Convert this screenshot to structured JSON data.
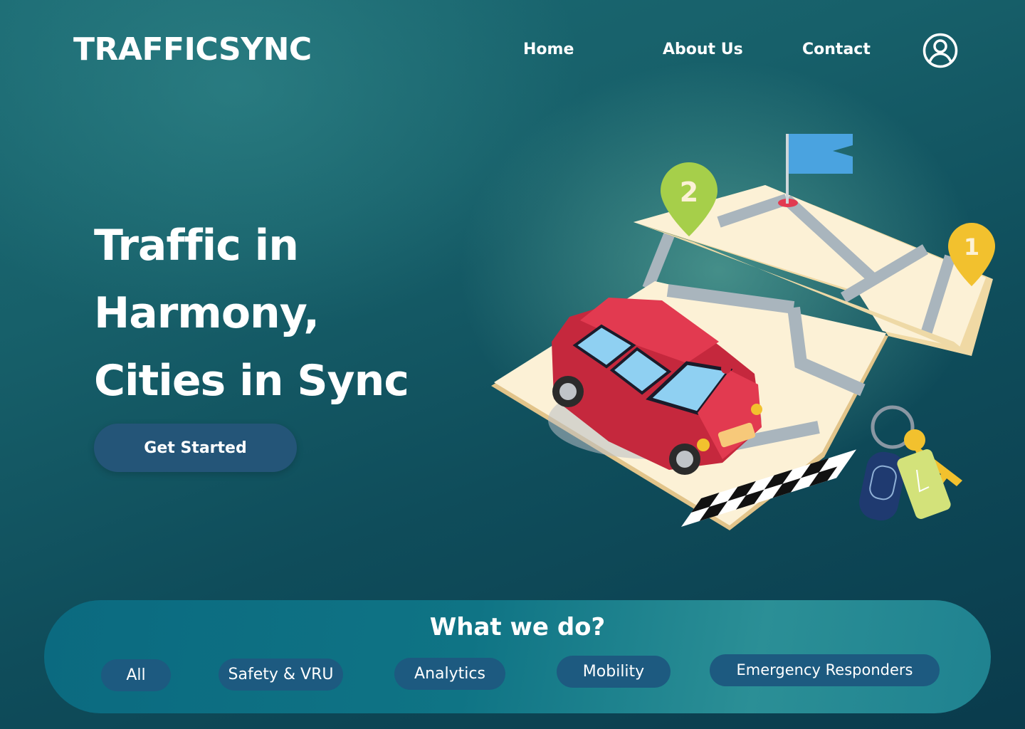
{
  "header": {
    "logo": "TRAFFICSYNC",
    "nav": {
      "home": "Home",
      "about": "About Us",
      "contact": "Contact"
    },
    "account_icon": "user-circle-icon"
  },
  "hero": {
    "title_lines": [
      "Traffic in",
      "Harmony,",
      "Cities in Sync"
    ],
    "cta_label": "Get Started",
    "illustration": {
      "pin_left_number": "2",
      "pin_right_number": "1"
    }
  },
  "services": {
    "title": "What we do?",
    "filters": [
      "All",
      "Safety & VRU",
      "Analytics",
      "Mobility",
      "Emergency Responders"
    ]
  },
  "colors": {
    "background": "#17606a",
    "button": "#245578",
    "pill": "#1d5a80",
    "panel": "#0f7485",
    "car": "#e23a50",
    "pin_green": "#a6cf4a",
    "pin_yellow": "#f2c12e",
    "flag": "#4aa3e0"
  }
}
